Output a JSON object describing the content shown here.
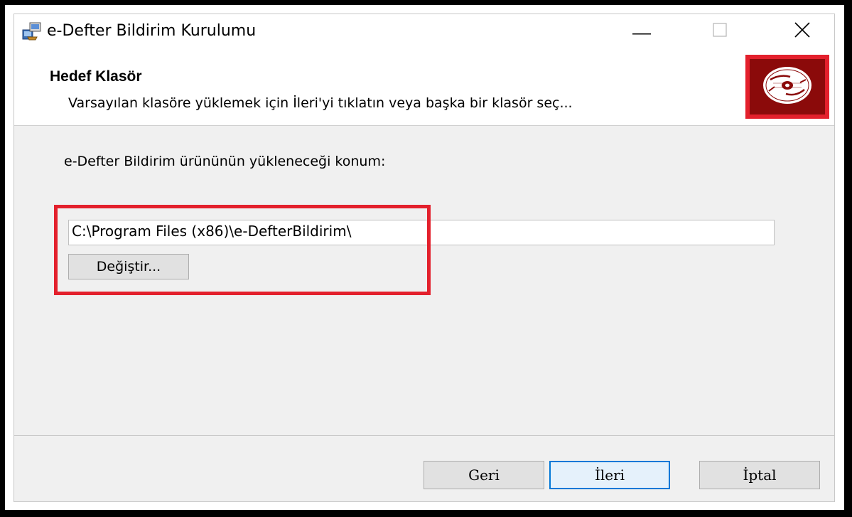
{
  "window": {
    "title": "e-Defter Bildirim Kurulumu",
    "icons": {
      "app": "installer-icon",
      "minimize": "minimize-icon",
      "maximize": "maximize-icon",
      "close": "close-icon"
    }
  },
  "banner": {
    "title": "Hedef Klasör",
    "subtitle": "Varsayılan klasöre yüklemek için İleri'yi tıklatın veya başka bir klasör seç...",
    "logo_icon": "disc-icon",
    "logo_color": "#8b0a0a",
    "logo_border_color": "#e3202c"
  },
  "main": {
    "location_label": "e-Defter Bildirim ürününün yükleneceği konum:",
    "path_value": "C:\\Program Files (x86)\\e-DefterBildirim\\",
    "change_button_label": "Değiştir...",
    "highlight_color": "#e3202c"
  },
  "footer": {
    "back_label": "Geri",
    "next_label": "İleri",
    "cancel_label": "İptal",
    "focus_color": "#0078d7"
  }
}
